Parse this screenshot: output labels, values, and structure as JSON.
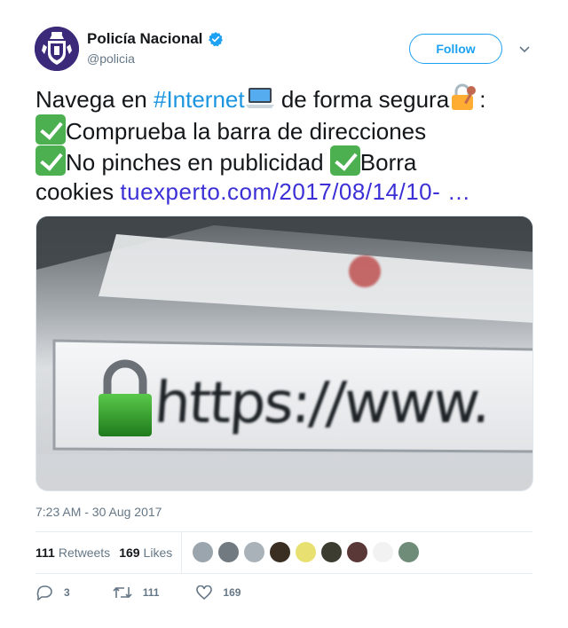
{
  "author": {
    "display_name": "Policía Nacional",
    "handle": "@policia",
    "verified": true,
    "brand_color": "#3b2a7a"
  },
  "follow_label": "Follow",
  "tweet": {
    "line1_a": "Navega en ",
    "hashtag": "#Internet",
    "line1_b": " de forma segura",
    "line1_c": ":",
    "line2": "Comprueba la barra de direcciones",
    "line3_a": "No pinches en publicidad ",
    "line3_b": "Borra",
    "line4_a": "cookies ",
    "link": "tuexperto.com/2017/08/14/10- …",
    "emojis": [
      "laptop-emoji",
      "locked-with-key-emoji",
      "check-mark-button-emoji"
    ]
  },
  "media": {
    "image_text": "https://www."
  },
  "timestamp": "7:23 AM - 30 Aug 2017",
  "stats": {
    "retweets_count": "111",
    "retweets_label": "Retweets",
    "likes_count": "169",
    "likes_label": "Likes"
  },
  "liker_avatars": [
    "#9aa5ad",
    "#707a80",
    "#a9b2b8",
    "#3a2e22",
    "#e8e070",
    "#3c3c30",
    "#5a3838",
    "#f2f2f2",
    "#6f8c78"
  ],
  "actions": {
    "reply_count": "3",
    "retweet_count": "111",
    "like_count": "169"
  },
  "colors": {
    "accent": "#1da1f2",
    "link": "#3b2fd6",
    "secondary_text": "#657786"
  }
}
